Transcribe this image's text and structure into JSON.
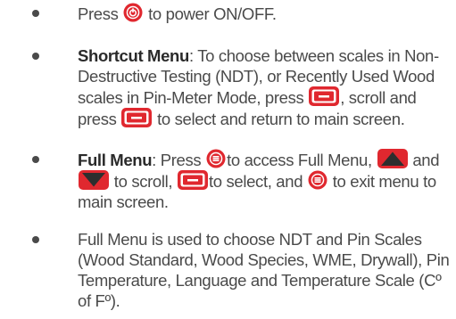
{
  "colors": {
    "text": "#4a4a4a",
    "term": "#2a2a2a",
    "button_red": "#e0282f",
    "arrow_dark": "#2e2e2e"
  },
  "icons": [
    "power-button-icon",
    "select-button-icon",
    "menu-button-icon",
    "up-arrow-button-icon",
    "down-arrow-button-icon"
  ],
  "items": [
    {
      "before": "Press",
      "after": "to power ON/OFF."
    },
    {
      "term": "Shortcut Menu",
      "text1": ": To choose between scales in Non-Destructive Testing (NDT), or Recently Used Wood scales in Pin-Meter Mode, press",
      "text2": ", scroll and press",
      "text3": "to select and return to main screen."
    },
    {
      "term": "Full Menu",
      "text1": ": Press",
      "text2": "to access Full Menu,",
      "text3": "and",
      "text4": "to scroll,",
      "text5": "to select, and",
      "text6": "to exit menu to main screen."
    },
    {
      "text": "Full Menu is used to choose NDT and Pin Scales (Wood Standard, Wood Species, WME, Drywall), Pin Temperature, Language and Temperature Scale (Cº of Fº)."
    }
  ]
}
